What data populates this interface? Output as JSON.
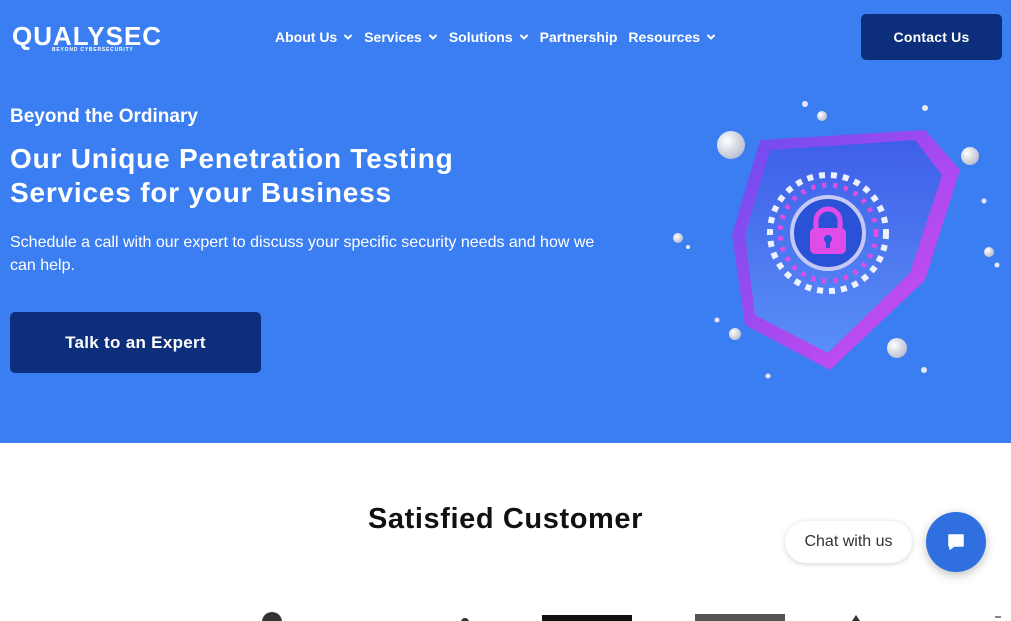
{
  "header": {
    "logo_text": "QUALYSEC",
    "logo_tagline": "BEYOND CYBERSECURITY",
    "nav": [
      {
        "label": "About Us",
        "dropdown": true
      },
      {
        "label": "Services",
        "dropdown": true
      },
      {
        "label": "Solutions",
        "dropdown": true
      },
      {
        "label": "Partnership",
        "dropdown": false
      },
      {
        "label": "Resources",
        "dropdown": true
      }
    ],
    "contact_label": "Contact Us"
  },
  "hero": {
    "eyebrow": "Beyond the Ordinary",
    "headline_line1": "Our Unique Penetration Testing",
    "headline_line2": "Services for your Business",
    "subtext": "Schedule a call with our expert to discuss your specific security needs and how we can help.",
    "cta_label": "Talk to an Expert",
    "illustration": "shield-lock-illustration"
  },
  "customers": {
    "title": "Satisfied Customer"
  },
  "chat": {
    "label": "Chat with us",
    "icon": "chat-bubble-icon"
  },
  "colors": {
    "hero_bg": "#3a7ef2",
    "button_dark": "#0d2e7a",
    "chat_button": "#2f6fe0"
  }
}
